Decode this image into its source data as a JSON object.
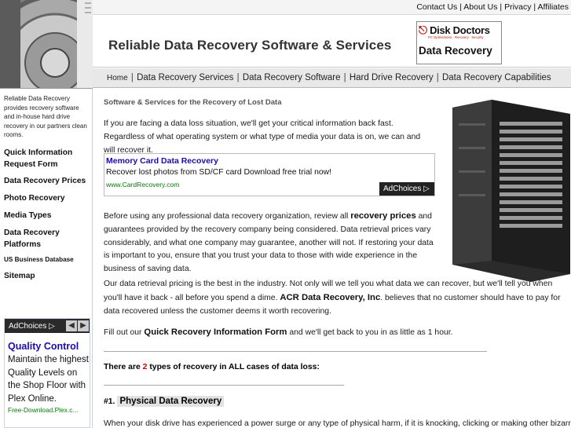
{
  "top_links": [
    "Contact Us",
    "About Us",
    "Privacy",
    "Affiliates"
  ],
  "header": {
    "title": "Reliable Data Recovery Software & Services",
    "logo_brand": "Disk Doctors",
    "logo_tagline": "PC Optimization · Recovery · Security",
    "logo_subtitle": "Data Recovery"
  },
  "main_nav": [
    "Home",
    "Data Recovery Services",
    "Data Recovery Software",
    "Hard Drive Recovery",
    "Data Recovery Capabilities"
  ],
  "sidebar": {
    "intro": "Reliable Data Recovery provides recovery software and in-house hard drive recovery in our partners clean rooms.",
    "items": [
      {
        "label": "Quick Information Request Form",
        "small": false
      },
      {
        "label": "Data Recovery Prices",
        "small": false
      },
      {
        "label": "Photo Recovery",
        "small": false
      },
      {
        "label": "Media Types",
        "small": false
      },
      {
        "label": "Data Recovery Platforms",
        "small": false
      },
      {
        "label": "US Business Database",
        "small": true
      },
      {
        "label": "Sitemap",
        "small": false
      }
    ],
    "ad": {
      "adchoices": "AdChoices ▷",
      "title": "Quality Control",
      "body": "Maintain the highest Quality Levels on the Shop Floor with Plex Online.",
      "url": "Free-Download.Plex.c..."
    }
  },
  "content": {
    "subtitle": "Software & Services for the Recovery of Lost Data",
    "para1": "If you are facing a data loss situation, we'll get your critical information back fast. Regardless of what operating system or what type of media your data is on, we can and will recover it.",
    "ad": {
      "title": "Memory Card Data Recovery",
      "desc": "Recover lost photos from SD/CF card Download free trial now!",
      "url": "www.CardRecovery.com",
      "adchoices": "AdChoices ▷"
    },
    "para2_pre": "Before using any professional data recovery organization, review all ",
    "para2_link": "recovery prices",
    "para2_post": " and guarantees provided by the recovery company being considered. Data retrieval prices vary considerably, and what one company may guarantee, another will not. If restoring your data is important to you, ensure that you trust your data to those with wide experience in the business of saving data.",
    "para3_pre": "Our data retrieval pricing is the best in the industry. Not only will we tell you what data we can recover, but we'll tell you when you'll have it back - all before you spend a dime. ",
    "para3_link": "ACR Data Recovery, Inc",
    "para3_post": ". believes that no customer should have to pay for data recovered unless the customer deems it worth recovering.",
    "para4_pre": "Fill out our ",
    "para4_link": "Quick Recovery Information Form",
    "para4_post": " and we'll get back to you in as little as 1 hour.",
    "types_pre": "There are ",
    "types_num": "2",
    "types_post": " types of recovery in ALL cases of data loss:",
    "section1_num": "#1.",
    "section1_title": "Physical Data Recovery",
    "para5": "When your disk drive has experienced a power surge or any type of physical harm, if it is knocking, clicking or making other bizarre"
  },
  "colors": {
    "ad_title": "#1a0dab",
    "ad_url": "#0a7a0a",
    "highlight": "#cc0000"
  }
}
